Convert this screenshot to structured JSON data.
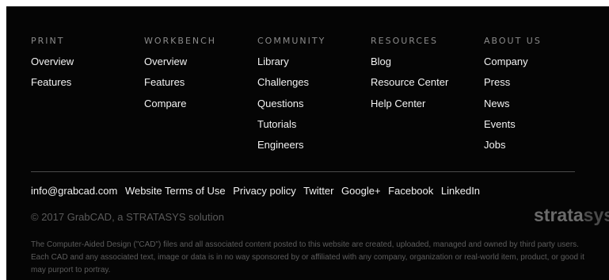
{
  "columns": [
    {
      "heading": "PRINT",
      "links": [
        "Overview",
        "Features"
      ]
    },
    {
      "heading": "WORKBENCH",
      "links": [
        "Overview",
        "Features",
        "Compare"
      ]
    },
    {
      "heading": "COMMUNITY",
      "links": [
        "Library",
        "Challenges",
        "Questions",
        "Tutorials",
        "Engineers"
      ]
    },
    {
      "heading": "RESOURCES",
      "links": [
        "Blog",
        "Resource Center",
        "Help Center"
      ]
    },
    {
      "heading": "ABOUT US",
      "links": [
        "Company",
        "Press",
        "News",
        "Events",
        "Jobs"
      ]
    }
  ],
  "bottom_links": [
    "info@grabcad.com",
    "Website Terms of Use",
    "Privacy policy",
    "Twitter",
    "Google+",
    "Facebook",
    "LinkedIn"
  ],
  "copyright": "© 2017 GrabCAD, a STRATASYS solution",
  "brand": {
    "part1": "strata",
    "part2": "sys"
  },
  "disclaimer": "The Computer-Aided Design (\"CAD\") files and all associated content posted to this website are created, uploaded, managed and owned by third party users. Each CAD and any associated text, image or data is in no way sponsored by or affiliated with any company, organization or real-world item, product, or good it may purport to portray.",
  "colors": {
    "background": "#050505",
    "link": "#f2f2f2",
    "heading": "#8a8a8a",
    "muted": "#5a5a5a"
  }
}
